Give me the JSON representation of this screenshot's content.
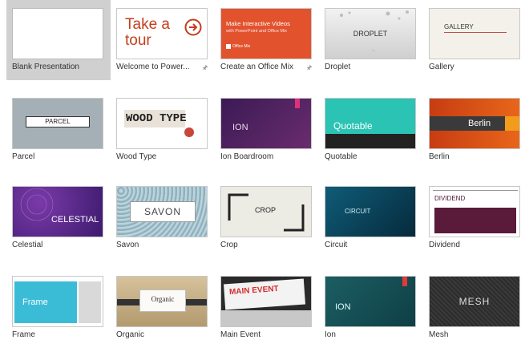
{
  "templates": [
    {
      "label": "Blank Presentation"
    },
    {
      "label": "Welcome to Power...",
      "thumb_text": [
        "Take a",
        "tour"
      ],
      "pin": "pin-icon"
    },
    {
      "label": "Create an Office Mix",
      "thumb_text": [
        "Make Interactive Videos",
        "with PowerPoint and Office Mix",
        "Office Mix"
      ],
      "pin": "pin-icon"
    },
    {
      "label": "Droplet",
      "thumb_text": "DROPLET"
    },
    {
      "label": "Gallery",
      "thumb_text": "GALLERY"
    },
    {
      "label": "Parcel",
      "thumb_text": "PARCEL"
    },
    {
      "label": "Wood Type",
      "thumb_text": "WOOD TYPE"
    },
    {
      "label": "Ion Boardroom",
      "thumb_text": "ION"
    },
    {
      "label": "Quotable",
      "thumb_text": "Quotable"
    },
    {
      "label": "Berlin",
      "thumb_text": "Berlin"
    },
    {
      "label": "Celestial",
      "thumb_text": "CELESTIAL"
    },
    {
      "label": "Savon",
      "thumb_text": "SAVON"
    },
    {
      "label": "Crop",
      "thumb_text": "CROP"
    },
    {
      "label": "Circuit",
      "thumb_text": "CIRCUIT"
    },
    {
      "label": "Dividend",
      "thumb_text": "DIVIDEND"
    },
    {
      "label": "Frame",
      "thumb_text": "Frame"
    },
    {
      "label": "Organic",
      "thumb_text": "Organic"
    },
    {
      "label": "Main Event",
      "thumb_text": "MAIN EVENT"
    },
    {
      "label": "Ion",
      "thumb_text": "ION"
    },
    {
      "label": "Mesh",
      "thumb_text": "MESH"
    }
  ],
  "colors": {
    "accent": "#d24726",
    "selected_bg": "#d0d0d0"
  }
}
